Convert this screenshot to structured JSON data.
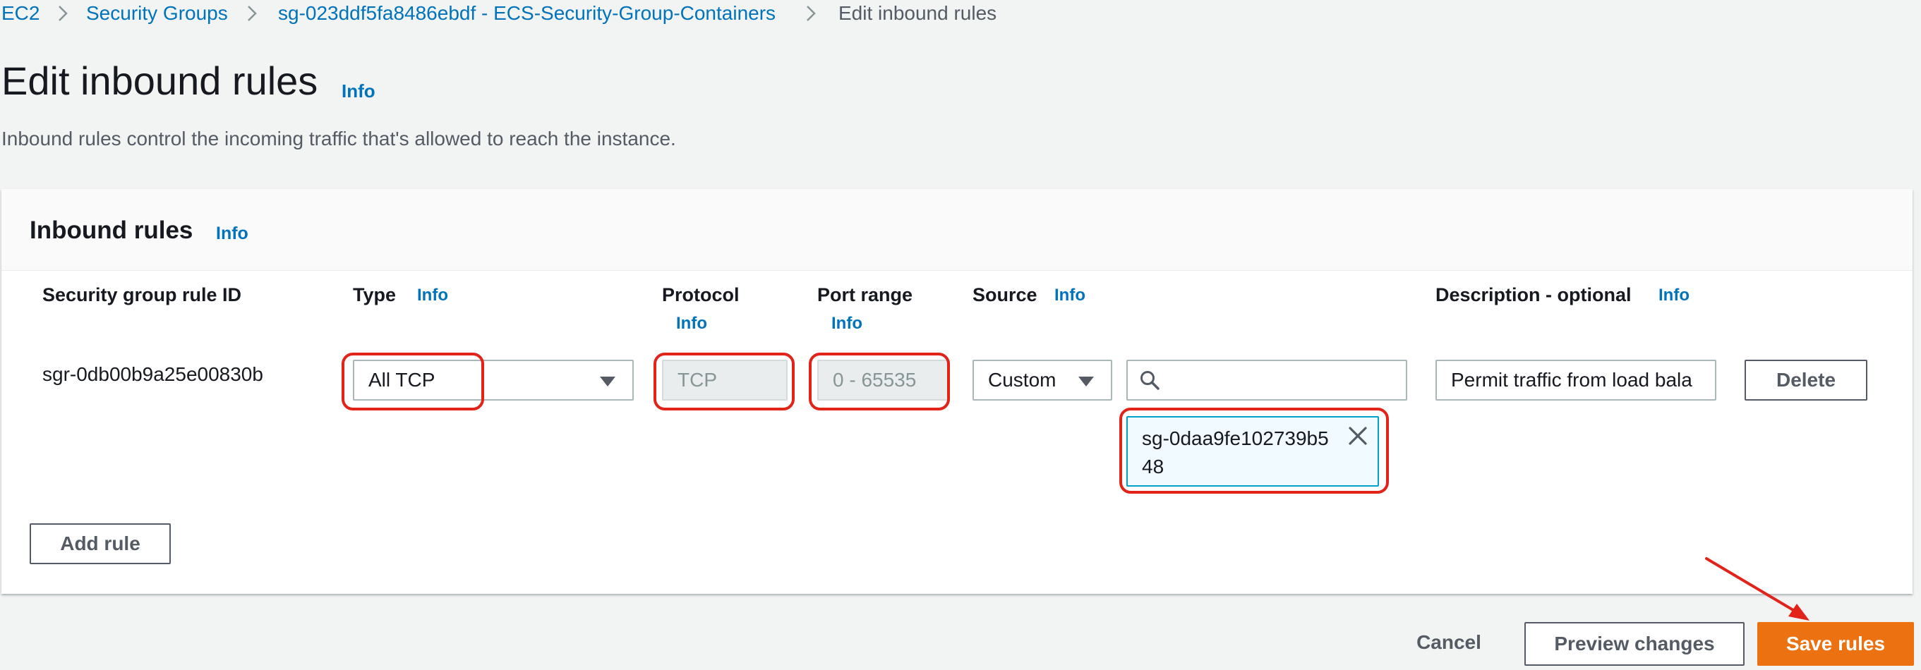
{
  "breadcrumb": {
    "items": [
      "EC2",
      "Security Groups",
      "sg-023ddf5fa8486ebdf - ECS-Security-Group-Containers"
    ],
    "current": "Edit inbound rules"
  },
  "page": {
    "title": "Edit inbound rules",
    "title_info": "Info",
    "description": "Inbound rules control the incoming traffic that's allowed to reach the instance."
  },
  "panel": {
    "title": "Inbound rules",
    "title_info": "Info"
  },
  "columns": {
    "rule_id": "Security group rule ID",
    "type": "Type",
    "type_info": "Info",
    "protocol": "Protocol",
    "protocol_info": "Info",
    "port_range": "Port range",
    "port_info": "Info",
    "source": "Source",
    "source_info": "Info",
    "description": "Description - optional",
    "description_info": "Info"
  },
  "rule": {
    "id": "sgr-0db00b9a25e00830b",
    "type": "All TCP",
    "protocol": "TCP",
    "port_range": "0 - 65535",
    "source_type": "Custom",
    "source_search_value": "",
    "source_token": "sg-0daa9fe102739b548",
    "description": "Permit traffic from load bala",
    "delete_label": "Delete"
  },
  "actions": {
    "add_rule": "Add rule",
    "cancel": "Cancel",
    "preview": "Preview changes",
    "save": "Save rules"
  },
  "colors": {
    "link": "#0073bb",
    "primary": "#ec7211",
    "annotation": "#e2231a"
  },
  "icons": [
    "chevron-right-icon",
    "caret-down-icon",
    "search-icon",
    "close-icon"
  ]
}
